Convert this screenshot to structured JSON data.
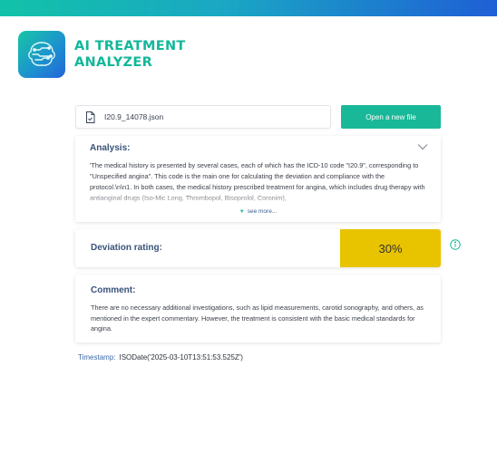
{
  "brand": {
    "line1": "AI TREATMENT",
    "line2": "ANALYZER",
    "color": "#13b79a"
  },
  "file": {
    "name": "I20.9_14078.json",
    "icon": "file-icon",
    "open_button_label": "Open a new file"
  },
  "analysis": {
    "title": "Analysis:",
    "text": "'The medical history is presented by several cases, each of which has the ICD-10 code \"I20.9\", corresponding to \"Unspecified angina\". This code is the main one for calculating the deviation and compliance with the protocol.\\n\\n1. In both cases, the medical history prescribed treatment for angina, which includes drug therapy with antianginal drugs (Iso-Mic Long, Thrombopol, Bisoprolol, Coronim),",
    "see_more_label": "see more...",
    "collapse_icon": "chevron-down-icon"
  },
  "deviation": {
    "label": "Deviation rating:",
    "value": "30%",
    "fraction": 0.3,
    "color": "#e8c300",
    "info_icon": "info-icon"
  },
  "comment": {
    "title": "Comment:",
    "text": "There are no necessary additional investigations, such as lipid measurements, carotid sonography, and others, as mentioned in the expert commentary. However, the treatment is consistent with the basic medical standards for angina."
  },
  "timestamp": {
    "label": "Timestamp:",
    "value": "ISODate('2025-03-10T13:51:53.525Z')"
  },
  "colors": {
    "accent": "#19b898",
    "heading": "#39527a"
  }
}
